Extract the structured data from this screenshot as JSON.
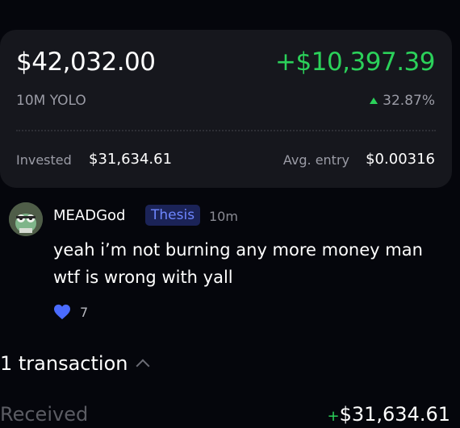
{
  "position": {
    "value": "$42,032.00",
    "pnl": "+$10,397.39",
    "coin_name": "10M YOLO",
    "pnl_percent": "32.87%",
    "invested_label": "Invested",
    "invested_value": "$31,634.61",
    "avg_entry_label": "Avg. entry",
    "avg_entry_value": "$0.00316"
  },
  "post": {
    "username": "MEADGod",
    "badge": "Thesis",
    "time": "10m",
    "text": "yeah i’m not burning any more money man wtf is wrong with yall",
    "likes": "7"
  },
  "transactions": {
    "header": "1 transaction",
    "items": [
      {
        "type": "Received",
        "sign": "+",
        "amount": "$31,634.61"
      }
    ]
  },
  "colors": {
    "positive": "#2bd15a",
    "badge_text": "#6e86ff",
    "like": "#4a6bff"
  },
  "icons": [
    "triangle-up-icon",
    "heart-icon",
    "chevron-up-icon",
    "avatar-image"
  ]
}
